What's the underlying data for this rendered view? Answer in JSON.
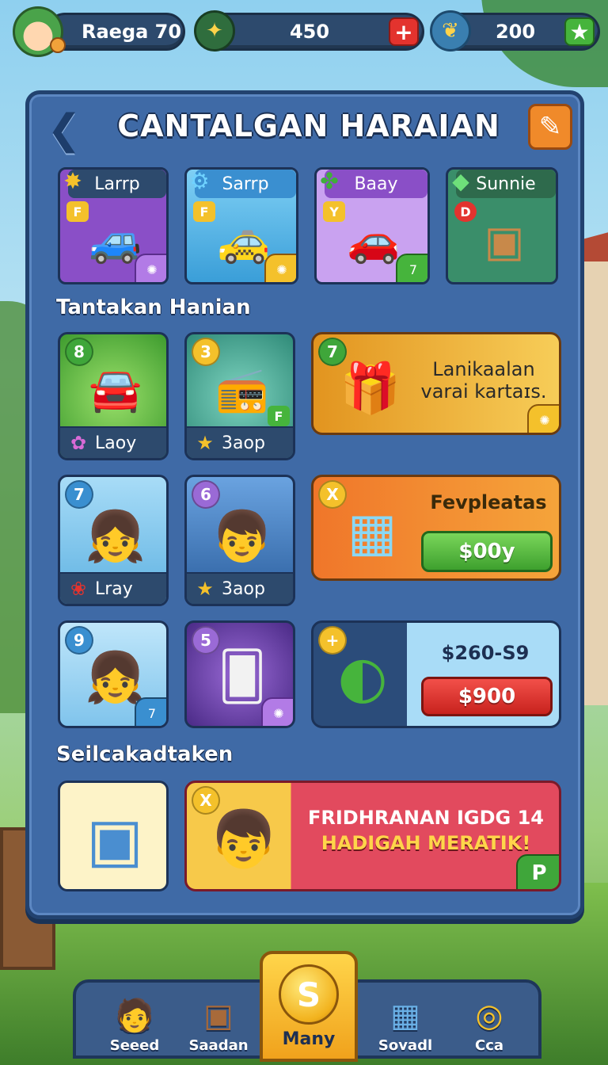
{
  "player": {
    "name": "Raega 70"
  },
  "currency": {
    "coins": "450",
    "gems": "200"
  },
  "panel": {
    "title": "CANTALGAN HARAIAN",
    "featured_cards": [
      {
        "label": "Larrp",
        "badge": "F",
        "icon": "car-icon"
      },
      {
        "label": "Sarrp",
        "badge": "F",
        "icon": "car-icon"
      },
      {
        "label": "Baay",
        "badge": "Y",
        "icon": "car-icon"
      },
      {
        "label": "Sunnie",
        "badge": "D",
        "icon": "crate-icon"
      }
    ],
    "section_daily": "Tantakan Hanian",
    "tiles": [
      {
        "num": "8",
        "caption": "Laoy"
      },
      {
        "num": "3",
        "caption": "3aop",
        "corner": "F"
      },
      {
        "num": "7",
        "caption": "Lray"
      },
      {
        "num": "6",
        "caption": "3aop"
      },
      {
        "num": "9",
        "corner": "7"
      },
      {
        "num": "5"
      }
    ],
    "offer_gift": {
      "num": "7",
      "text": "Lanikaalan varai kartaɪs."
    },
    "offer_cube": {
      "badge": "X",
      "title": "Fevpleatas",
      "price": "$00y"
    },
    "offer_ring": {
      "price_range": "$260-S9",
      "price": "$900"
    },
    "section_special": "Seilcakadtaken",
    "bundle": {
      "badge": "X",
      "line1": "FRIDHRANAN IGDG 14",
      "line2": "HADIGAH MERATIK!",
      "corner": "P"
    }
  },
  "nav": {
    "items": [
      {
        "label": "Seeed"
      },
      {
        "label": "Saadan"
      },
      {
        "label": "Many"
      },
      {
        "label": "Sovadl"
      },
      {
        "label": "Cca"
      }
    ]
  },
  "colors": {
    "panel": "#3f6aa6",
    "accent_orange": "#f08a2a",
    "buy_green": "#46b43c",
    "buy_red": "#e3332e",
    "gold": "#f2b21d"
  }
}
